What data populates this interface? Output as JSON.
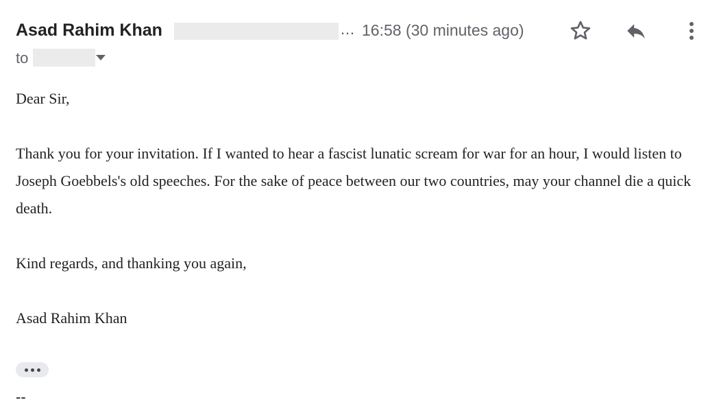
{
  "header": {
    "sender_name": "Asad Rahim Khan",
    "ellipsis": "…",
    "timestamp": "16:58 (30 minutes ago)"
  },
  "recipient": {
    "to_label": "to"
  },
  "icons": {
    "star": "star-outline-icon",
    "reply": "reply-icon",
    "more": "more-vertical-icon",
    "dropdown": "caret-down-icon",
    "trimmed": "show-trimmed-content-icon"
  },
  "message": {
    "greeting": "Dear Sir,",
    "paragraph": "Thank you for your invitation. If I wanted to hear a fascist lunatic scream for war for an hour, I would listen to Joseph Goebbels's old speeches. For the sake of peace between our two countries, may your channel die a quick death.",
    "closing": "Kind regards, and thanking you again,",
    "signature": "Asad Rahim Khan",
    "signature_separator": "--"
  },
  "colors": {
    "text": "#222222",
    "muted": "#5f6368",
    "redaction": "#ebebeb",
    "chip": "#e8eaed"
  }
}
